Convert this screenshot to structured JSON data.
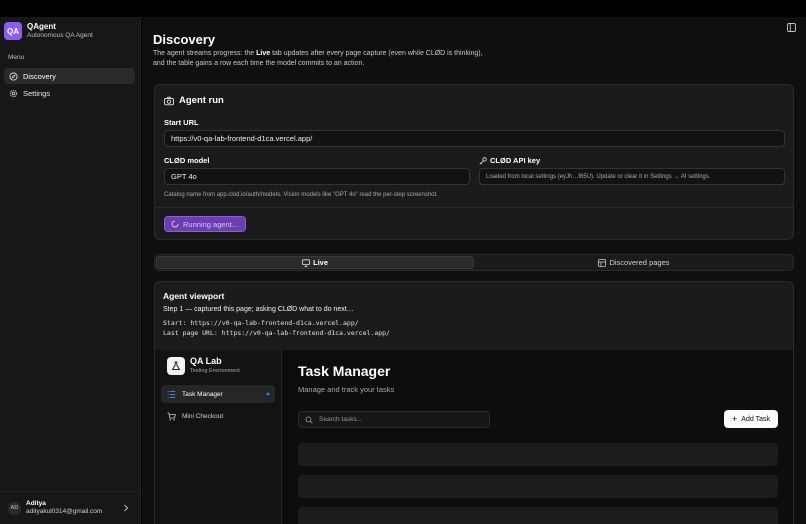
{
  "app": {
    "logo": "QA",
    "name": "QAgent",
    "subtitle": "Autonomous QA Agent"
  },
  "sidebar": {
    "menu_label": "Menu",
    "items": [
      {
        "label": "Discovery",
        "icon": "compass-icon",
        "active": true
      },
      {
        "label": "Settings",
        "icon": "gear-icon",
        "active": false
      }
    ]
  },
  "user": {
    "initials": "AD",
    "name": "Aditya",
    "email": "adityakul0314@gmail.com"
  },
  "page": {
    "title": "Discovery",
    "desc_pre": "The agent streams progress: the ",
    "desc_bold": "Live",
    "desc_post": " tab updates after every page capture (even while CLØD is thinking), and the table gains a row each time the model commits to an action."
  },
  "agent_run": {
    "title": "Agent run",
    "start_url_label": "Start URL",
    "start_url_value": "https://v0-qa-lab-frontend-d1ca.vercel.app/",
    "model_label": "CLØD model",
    "model_value": "GPT 4o",
    "api_key_label": "CLØD API key",
    "api_key_value": "Loaded from local settings (eyJh…f65U). Update or clear it in Settings → AI settings.",
    "model_hint": "Catalog name from app.clod.io/auth/models. Vision models like \"GPT 4o\" read the per-step screenshot.",
    "run_button": "Running agent..."
  },
  "tabs": [
    {
      "label": "Live",
      "icon": "monitor-icon",
      "active": true
    },
    {
      "label": "Discovered pages",
      "icon": "table-icon",
      "active": false
    }
  ],
  "viewport": {
    "title": "Agent viewport",
    "step": "Step 1 — captured this page; asking CLØD what to do next…",
    "start_line": "Start: https://v0-qa-lab-frontend-d1ca.vercel.app/",
    "last_line": "Last page URL: https://v0-qa-lab-frontend-d1ca.vercel.app/"
  },
  "preview": {
    "brand_name": "QA Lab",
    "brand_sub": "Testing Environment",
    "nav": [
      {
        "label": "Task Manager",
        "icon": "list-icon",
        "active": true
      },
      {
        "label": "Mini Checkout",
        "icon": "cart-icon",
        "active": false
      }
    ],
    "title": "Task Manager",
    "desc": "Manage and track your tasks",
    "search_placeholder": "Search tasks...",
    "add_button": "Add Task"
  }
}
